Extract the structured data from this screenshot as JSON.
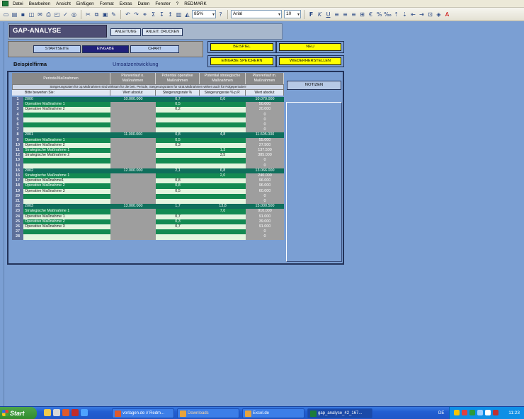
{
  "menu": [
    "Datei",
    "Bearbeiten",
    "Ansicht",
    "Einfügen",
    "Format",
    "Extras",
    "Daten",
    "Fenster",
    "?",
    "REDMARK"
  ],
  "toolbar": {
    "zoom": "85%",
    "font": "Arial",
    "font_size": "10"
  },
  "header": {
    "title": "GAP-ANALYSE",
    "btn_anleitung": "ANLEITUNG",
    "btn_drucken": "ANLEIT. DRUCKEN"
  },
  "nav": {
    "startseite": "STARTSEITE",
    "eingabe": "EINGABE",
    "chart": "CHART"
  },
  "actions": {
    "beispiel": "BEISPIEL",
    "neu": "NEU",
    "speichern": "EINGABE SPEICHERN",
    "wiederherstellen": "WIEDERHERSTELLEN"
  },
  "company": "Beispielfirma",
  "subtitle": "Umsatzentwicklung",
  "notes_button": "NOTIZEN",
  "table": {
    "headers": [
      "Periode/Maßnahmen",
      "Planverlauf o. Maßnahmen",
      "Potential operative Maßnahmen",
      "Potential strategische Maßnahmen",
      "Planverlauf m. Maßnahmen"
    ],
    "note": "Steigerungsraten für op.Maßnahmen sind wirksam für die betr. Periode, Steigerungsraten für strat.Maßnahmen wirken auch für Folgeperioden!",
    "subheaders": [
      "Bitte bewerten Sie:",
      "Wert absolut",
      "Steigerungsrate %",
      "Steigerungsrate % p.P.",
      "Wert absolut"
    ],
    "rows": [
      {
        "n": "1",
        "name": "2000",
        "plan": "10.000.000",
        "op": "0,7",
        "st": "0,0",
        "pl2": "10.070.000",
        "type": "year"
      },
      {
        "n": "2",
        "name": "Operative Maßnahme 1",
        "plan": "",
        "op": "0,5",
        "st": "",
        "pl2": "50.000",
        "type": "green"
      },
      {
        "n": "3",
        "name": "Operative Maßnahme 2",
        "plan": "",
        "op": "0,2",
        "st": "",
        "pl2": "20.000",
        "type": "light"
      },
      {
        "n": "4",
        "name": "",
        "plan": "",
        "op": "",
        "st": "",
        "pl2": "0",
        "type": "green"
      },
      {
        "n": "5",
        "name": "",
        "plan": "",
        "op": "",
        "st": "",
        "pl2": "0",
        "type": "light"
      },
      {
        "n": "6",
        "name": "",
        "plan": "",
        "op": "",
        "st": "",
        "pl2": "0",
        "type": "green"
      },
      {
        "n": "7",
        "name": "",
        "plan": "",
        "op": "",
        "st": "",
        "pl2": "0",
        "type": "light"
      },
      {
        "n": "8",
        "name": "2001",
        "plan": "11.000.000",
        "op": "0,8",
        "st": "4,8",
        "pl2": "11.605.000",
        "type": "year"
      },
      {
        "n": "9",
        "name": "Operative Maßnahme 1",
        "plan": "",
        "op": "0,5",
        "st": "",
        "pl2": "55.000",
        "type": "green"
      },
      {
        "n": "10",
        "name": "Operative Maßnahme 2",
        "plan": "",
        "op": "0,3",
        "st": "",
        "pl2": "27.500",
        "type": "light"
      },
      {
        "n": "11",
        "name": "Strategische Maßnahme 1",
        "plan": "",
        "op": "",
        "st": "1,3",
        "pl2": "137.500",
        "type": "green"
      },
      {
        "n": "12",
        "name": "Strategische Maßnahme 2",
        "plan": "",
        "op": "",
        "st": "3,5",
        "pl2": "385.000",
        "type": "light"
      },
      {
        "n": "13",
        "name": "",
        "plan": "",
        "op": "",
        "st": "",
        "pl2": "0",
        "type": "green"
      },
      {
        "n": "14",
        "name": "",
        "plan": "",
        "op": "",
        "st": "",
        "pl2": "0",
        "type": "light"
      },
      {
        "n": "15",
        "name": "2002",
        "plan": "12.000.000",
        "op": "2,1",
        "st": "6,8",
        "pl2": "13.066.000",
        "type": "year"
      },
      {
        "n": "16",
        "name": "Strategische Maßnahme 1",
        "plan": "",
        "op": "",
        "st": "2,0",
        "pl2": "240.000",
        "type": "green"
      },
      {
        "n": "17",
        "name": "Operative Maßnahme1",
        "plan": "",
        "op": "0,8",
        "st": "",
        "pl2": "96.000",
        "type": "light"
      },
      {
        "n": "18",
        "name": "Operative Maßnahme 2",
        "plan": "",
        "op": "0,8",
        "st": "",
        "pl2": "96.000",
        "type": "green"
      },
      {
        "n": "19",
        "name": "Operative Maßnahme 3",
        "plan": "",
        "op": "0,5",
        "st": "",
        "pl2": "60.000",
        "type": "light"
      },
      {
        "n": "20",
        "name": "",
        "plan": "",
        "op": "",
        "st": "",
        "pl2": "0",
        "type": "green"
      },
      {
        "n": "21",
        "name": "",
        "plan": "",
        "op": "",
        "st": "",
        "pl2": "0",
        "type": "light"
      },
      {
        "n": "22",
        "name": "2003",
        "plan": "13.000.000",
        "op": "1,7",
        "st": "13,8",
        "pl2": "15.000.500",
        "type": "year"
      },
      {
        "n": "23",
        "name": "Strategische Maßnahme 1",
        "plan": "",
        "op": "",
        "st": "7,0",
        "pl2": "910.000",
        "type": "green"
      },
      {
        "n": "24",
        "name": "Operative Maßnahme 1",
        "plan": "",
        "op": "0,7",
        "st": "",
        "pl2": "91.000",
        "type": "light"
      },
      {
        "n": "25",
        "name": "Operative Maßnahme 2",
        "plan": "",
        "op": "0,3",
        "st": "",
        "pl2": "39.000",
        "type": "green"
      },
      {
        "n": "26",
        "name": "Operative Maßnahme 3",
        "plan": "",
        "op": "0,7",
        "st": "",
        "pl2": "91.000",
        "type": "light"
      },
      {
        "n": "27",
        "name": "",
        "plan": "",
        "op": "",
        "st": "",
        "pl2": "0",
        "type": "green"
      },
      {
        "n": "28",
        "name": "",
        "plan": "",
        "op": "",
        "st": "",
        "pl2": "0",
        "type": "light"
      }
    ]
  },
  "taskbar": {
    "start": "Start",
    "tasks": [
      "vorlagen.de // Redm...",
      "Downloads",
      "Excel.de",
      "gap_analyse_42_167..."
    ],
    "lang": "DE",
    "clock": "11:23"
  }
}
